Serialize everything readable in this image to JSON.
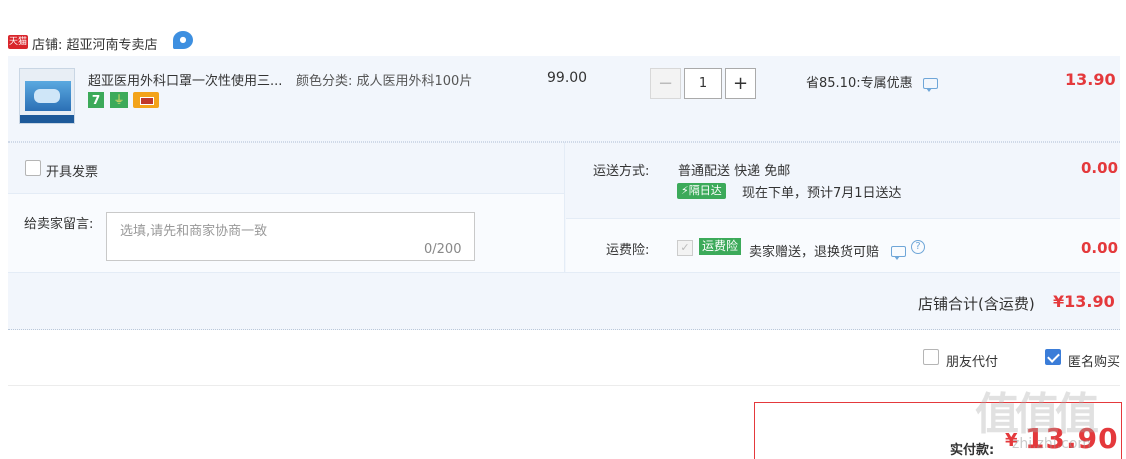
{
  "shop": {
    "platform_badge": "天猫",
    "label": "店铺: 超亚河南专卖店",
    "chat_icon": "wangwang-chat-icon"
  },
  "item": {
    "title": "超亚医用外科口罩一次性使用三...",
    "sku": "颜色分类: 成人医用外科100片",
    "unit_price": "99.00",
    "quantity": "1",
    "minus_label": "−",
    "plus_label": "+",
    "discount": "省85.10:专属优惠",
    "total": "13.90",
    "service_icons": [
      "7",
      "plug-icon",
      "card-icon"
    ]
  },
  "invoice": {
    "label": "开具发票"
  },
  "message": {
    "label": "给卖家留言:",
    "placeholder": "选填,请先和商家协商一致",
    "counter": "0/200"
  },
  "shipping": {
    "label": "运送方式:",
    "method": "普通配送 快递 免邮",
    "badge": "隔日达",
    "eta": "现在下单，预计7月1日送达",
    "fee": "0.00"
  },
  "insurance": {
    "label": "运费险:",
    "badge": "运费险",
    "desc": "卖家赠送，退换货可赔",
    "help": "?",
    "fee": "0.00"
  },
  "shop_total": {
    "label": "店铺合计(含运费)",
    "value": "¥13.90"
  },
  "options": {
    "friend_pay": "朋友代付",
    "anonymous": "匿名购买",
    "anonymous_checked": true
  },
  "payment": {
    "label": "实付款:",
    "currency": "¥",
    "amount": "13.90"
  },
  "watermark": {
    "glyphs": "值值值",
    "site": "zhi.zhi.com"
  },
  "colors": {
    "price_red": "#e4393c",
    "row_bg": "#f2f6fc",
    "green_badge": "#3caa5a",
    "check_blue": "#3b7dd8"
  }
}
